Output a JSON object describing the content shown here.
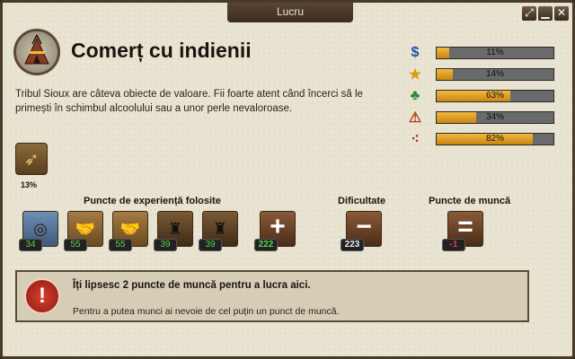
{
  "window": {
    "title": "Lucru"
  },
  "job": {
    "name": "Comerț cu indienii",
    "description": "Tribul Sioux are câteva obiecte de valoare. Fii foarte atent când încerci să le primești în schimbul alcoolului sau a unor perle nevaloroase."
  },
  "stats": [
    {
      "icon": "dollar-icon",
      "glyph": "$",
      "color": "#1f4fb0",
      "value": 11,
      "label": "11%"
    },
    {
      "icon": "star-icon",
      "glyph": "★",
      "color": "#d89a10",
      "value": 14,
      "label": "14%"
    },
    {
      "icon": "clover-icon",
      "glyph": "♣",
      "color": "#2f8a2a",
      "value": 63,
      "label": "63%"
    },
    {
      "icon": "warning-icon",
      "glyph": "⚠",
      "color": "#b0401a",
      "value": 34,
      "label": "34%"
    },
    {
      "icon": "blood-drops-icon",
      "glyph": "⁖",
      "color": "#c01818",
      "value": 82,
      "label": "82%"
    }
  ],
  "product": {
    "icon": "cigar-icon",
    "chance": "13%"
  },
  "skills": {
    "label": "Puncte de experiență folosite",
    "items": [
      {
        "icon": "trap-icon",
        "value": "34"
      },
      {
        "icon": "handshake-icon",
        "value": "55"
      },
      {
        "icon": "handshake-icon",
        "value": "55"
      },
      {
        "icon": "cowboy-icon",
        "value": "39"
      },
      {
        "icon": "cowboy-icon",
        "value": "39"
      }
    ],
    "total": "222"
  },
  "difficulty": {
    "label": "Dificultate",
    "value": "223"
  },
  "labor": {
    "label": "Puncte de muncă",
    "value": "-1"
  },
  "alert": {
    "title": "Îți lipsesc 2 puncte de muncă pentru a lucra aici.",
    "text": "Pentru a putea munci ai nevoie de cel puțin un punct de muncă."
  },
  "colors": {
    "bar_fill": "#e0a22a",
    "bar_track": "#6a6a6a",
    "skill_value": "#5bd34b"
  }
}
